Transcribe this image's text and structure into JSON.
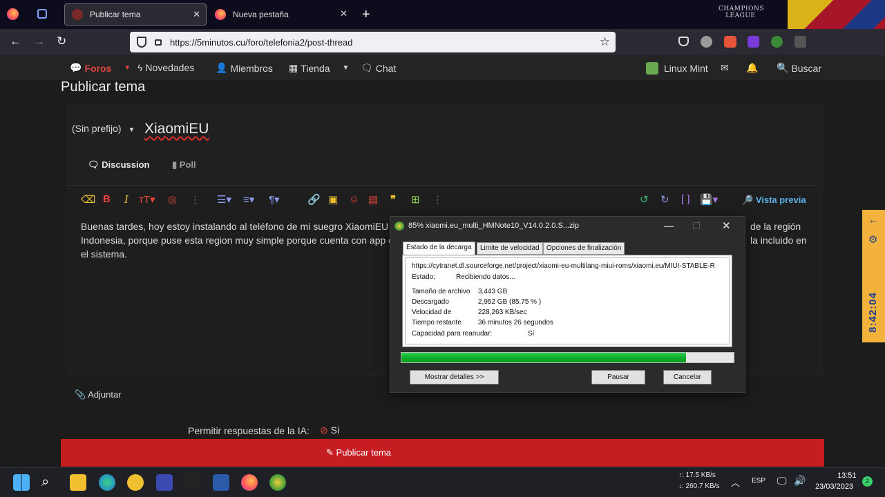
{
  "tabs": [
    {
      "label": "Publicar tema",
      "active": true
    },
    {
      "label": "Nueva pestaña",
      "active": false
    }
  ],
  "address_bar": {
    "url": "https://5minutos.cu/foro/telefonia2/post-thread"
  },
  "forum_nav": {
    "items": [
      "Foros",
      "Novedades",
      "Miembros",
      "Tienda",
      "Chat"
    ],
    "user": "Linux Mint",
    "search": "Buscar"
  },
  "page": {
    "title": "Publicar tema",
    "prefix": "(Sin prefijo)",
    "thread_title": "XiaomiEU",
    "tabs": [
      "Discussion",
      "Poll"
    ],
    "preview": "Vista previa",
    "body_lines": [
      "Buenas tardes, hoy estoy instalando al teléfono de mi suegro XiaomiEU",
      "Indonesia, porque puse esta region muy simple porque cuenta con app c",
      "el sistema."
    ],
    "body_right_lines": [
      "de la región",
      "la incluido en"
    ],
    "attach": "Adjuntar",
    "ai_label": "Permitir respuestas de la IA:",
    "ai_value": "Sí",
    "submit": "Publicar tema"
  },
  "download_dialog": {
    "title": "85% xiaomi.eu_multi_HMNote10_V14.0.2.0.S...zip",
    "tabs": [
      "Estado de la decarga",
      "Limite de velocidad",
      "Opciones de finalización"
    ],
    "url": "https://cytranet.dl.sourceforge.net/project/xiaomi-eu-multilang-miui-roms/xiaomi.eu/MIUI-STABLE-R",
    "status_label": "Estado:",
    "status_value": "Recibiendo datos...",
    "rows": [
      {
        "label": "Tamaño de archivo",
        "value": "3,443  GB"
      },
      {
        "label": "Descargado",
        "value": "2,952  GB  (85,75 % )"
      },
      {
        "label": "Velocidad de",
        "value": "228,263  KB/sec"
      },
      {
        "label": "Tiempo restante",
        "value": "36 minutos 26 segundos"
      },
      {
        "label": "Capacidad para reanudar:",
        "value": "Sí"
      }
    ],
    "progress": 0.8575,
    "buttons": {
      "details": "Mostrar detalles >>",
      "pause": "Pausar",
      "cancel": "Cancelar"
    }
  },
  "side_widget": {
    "time": "8:42:04"
  },
  "taskbar": {
    "upload": "↑: 17.5 KB/s",
    "download": "↓: 260.7 KB/s",
    "lang": "ESP",
    "time": "13:51",
    "date": "23/03/2023",
    "badge": "2"
  }
}
